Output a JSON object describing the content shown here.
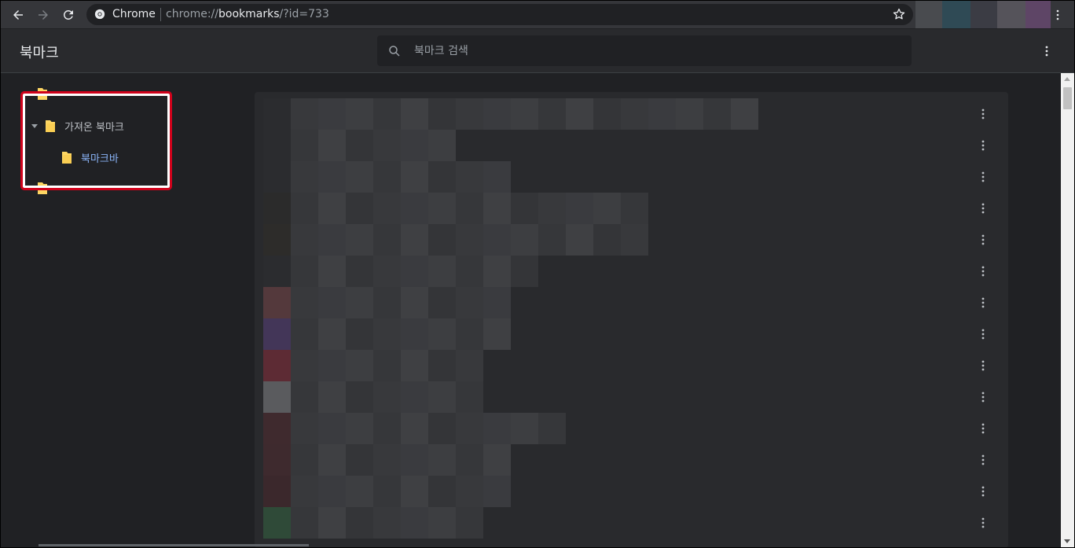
{
  "browser": {
    "site_name": "Chrome",
    "url_prefix": "chrome://",
    "url_host": "bookmarks",
    "url_path": "/?id=733",
    "ext_colors": [
      "#494b4f",
      "#2f4a55",
      "#3b3c44",
      "#55535a",
      "#5e4566"
    ]
  },
  "app": {
    "title": "북마크",
    "search_placeholder": "북마크 검색"
  },
  "sidebar": {
    "items": [
      {
        "label": "가져온 북마크",
        "expanded": true
      },
      {
        "label": "북마크바",
        "selected": true
      }
    ]
  },
  "list": {
    "row_count": 14,
    "rows_obscured": true,
    "favicon_colors": [
      "#2b2c2f",
      "#2b2c2f",
      "#2b2c2f",
      "#2b2b2b",
      "#2d2c2a",
      "#2b2c2f",
      "#54393c",
      "#433658",
      "#5d2b34",
      "#5a5b5e",
      "#3f2a2e",
      "#3e2a2e",
      "#3b282c",
      "#2f4a38",
      "#2b3b32",
      "#2b2c2f"
    ]
  },
  "colors": {
    "background": "#202124",
    "surface": "#292a2d",
    "selected_text": "#8ab4f8",
    "folder": "#fdd663",
    "highlight_box": "#d0021b"
  }
}
